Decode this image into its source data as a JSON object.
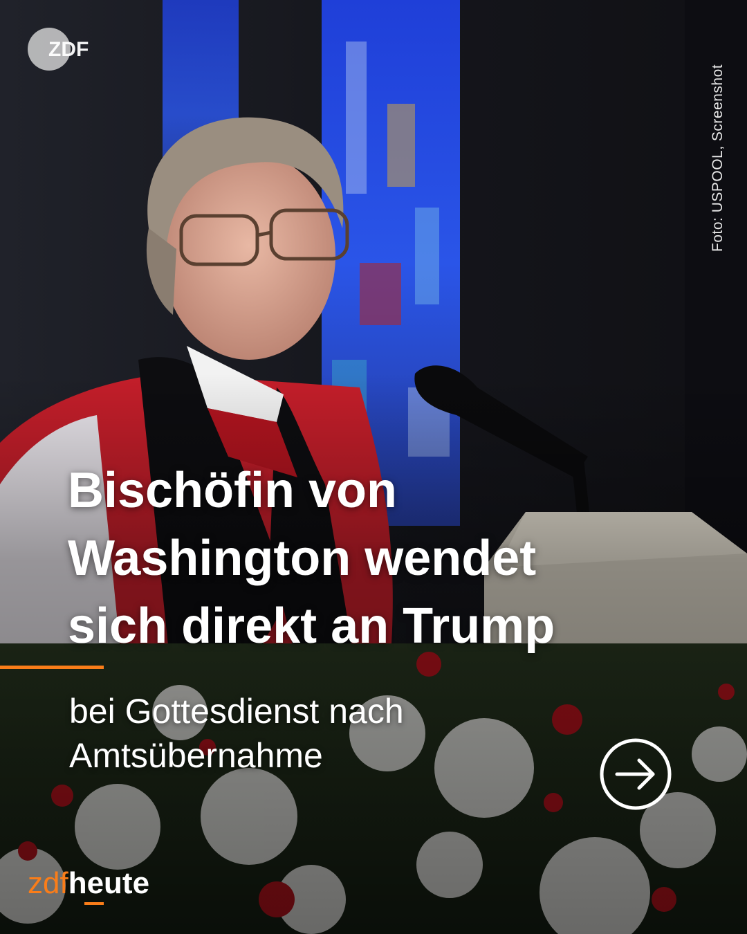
{
  "post": {
    "headline_lines": [
      "Bischöfin von",
      "Washington wendet",
      "sich direkt an Trump"
    ],
    "subline_lines": [
      "bei Gottesdienst nach",
      "Amtsübernahme"
    ],
    "photo_credit": "Foto: USPOOL, Screenshot"
  },
  "branding": {
    "top_logo": "ZDF",
    "bottom_brand_a": "zdf",
    "bottom_brand_b": "heute"
  },
  "icons": {
    "next": "arrow-right-circle-icon",
    "logo": "zdf-logo-icon"
  },
  "colors": {
    "accent": "#fa7d19",
    "text": "#ffffff",
    "credit": "#e9e9e9"
  }
}
